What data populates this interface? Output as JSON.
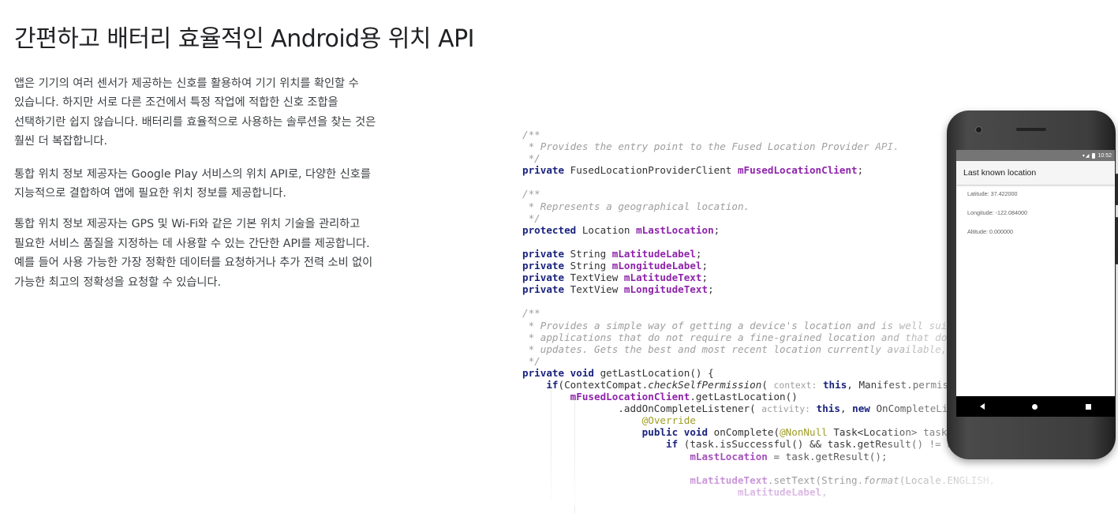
{
  "page": {
    "title": "간편하고 배터리 효율적인 Android용 위치 API",
    "paragraphs": [
      "앱은 기기의 여러 센서가 제공하는 신호를 활용하여 기기 위치를 확인할 수 있습니다. 하지만 서로 다른 조건에서 특정 작업에 적합한 신호 조합을 선택하기란 쉽지 않습니다. 배터리를 효율적으로 사용하는 솔루션을 찾는 것은 훨씬 더 복잡합니다.",
      "통합 위치 정보 제공자는 Google Play 서비스의 위치 API로, 다양한 신호를 지능적으로 결합하여 앱에 필요한 위치 정보를 제공합니다.",
      "통합 위치 정보 제공자는 GPS 및 Wi-Fi와 같은 기본 위치 기술을 관리하고 필요한 서비스 품질을 지정하는 데 사용할 수 있는 간단한 API를 제공합니다. 예를 들어 사용 가능한 가장 정확한 데이터를 요청하거나 추가 전력 소비 없이 가능한 최고의 정확성을 요청할 수 있습니다."
    ]
  },
  "code": {
    "lines": [
      [
        {
          "t": "/**",
          "c": "cm"
        }
      ],
      [
        {
          "t": " * Provides the entry point to the Fused Location Provider API.",
          "c": "cm"
        }
      ],
      [
        {
          "t": " */",
          "c": "cm"
        }
      ],
      [
        {
          "t": "private",
          "c": "kw"
        },
        {
          "t": " FusedLocationProviderClient "
        },
        {
          "t": "mFusedLocationClient",
          "c": "fd"
        },
        {
          "t": ";"
        }
      ],
      [],
      [
        {
          "t": "/**",
          "c": "cm"
        }
      ],
      [
        {
          "t": " * Represents a geographical location.",
          "c": "cm"
        }
      ],
      [
        {
          "t": " */",
          "c": "cm"
        }
      ],
      [
        {
          "t": "protected",
          "c": "kw"
        },
        {
          "t": " Location "
        },
        {
          "t": "mLastLocation",
          "c": "fd"
        },
        {
          "t": ";"
        }
      ],
      [],
      [
        {
          "t": "private",
          "c": "kw"
        },
        {
          "t": " String "
        },
        {
          "t": "mLatitudeLabel",
          "c": "fd"
        },
        {
          "t": ";"
        }
      ],
      [
        {
          "t": "private",
          "c": "kw"
        },
        {
          "t": " String "
        },
        {
          "t": "mLongitudeLabel",
          "c": "fd"
        },
        {
          "t": ";"
        }
      ],
      [
        {
          "t": "private",
          "c": "kw"
        },
        {
          "t": " TextView "
        },
        {
          "t": "mLatitudeText",
          "c": "fd"
        },
        {
          "t": ";"
        }
      ],
      [
        {
          "t": "private",
          "c": "kw"
        },
        {
          "t": " TextView "
        },
        {
          "t": "mLongitudeText",
          "c": "fd"
        },
        {
          "t": ";"
        }
      ],
      [],
      [
        {
          "t": "/**",
          "c": "cm"
        }
      ],
      [
        {
          "t": " * Provides a simple way of getting a device's location and is well suited for",
          "c": "cm"
        }
      ],
      [
        {
          "t": " * applications that do not require a fine-grained location and that do not need location",
          "c": "cm"
        }
      ],
      [
        {
          "t": " * updates. Gets the best and most recent location currently available, which may be null",
          "c": "cm"
        }
      ],
      [
        {
          "t": " */",
          "c": "cm"
        }
      ],
      [
        {
          "t": "private",
          "c": "kw"
        },
        {
          "t": " "
        },
        {
          "t": "void",
          "c": "kw"
        },
        {
          "t": " getLastLocation() {"
        }
      ],
      [
        {
          "t": "    "
        },
        {
          "t": "if",
          "c": "kw"
        },
        {
          "t": "(ContextCompat."
        },
        {
          "t": "checkSelfPermission",
          "c": "it"
        },
        {
          "t": "( "
        },
        {
          "t": "context:",
          "c": "hint"
        },
        {
          "t": " "
        },
        {
          "t": "this",
          "c": "kw"
        },
        {
          "t": ", Manifest.permission.ACCESS_FINE_LOCATION)"
        }
      ],
      [
        {
          "t": "        "
        },
        {
          "t": "mFusedLocationClient",
          "c": "fd"
        },
        {
          "t": ".getLastLocation()"
        }
      ],
      [
        {
          "t": "                .addOnCompleteListener( "
        },
        {
          "t": "activity:",
          "c": "hint"
        },
        {
          "t": " "
        },
        {
          "t": "this",
          "c": "kw"
        },
        {
          "t": ", "
        },
        {
          "t": "new",
          "c": "kw"
        },
        {
          "t": " OnCompleteListener<Location>() {"
        }
      ],
      [
        {
          "t": "                    "
        },
        {
          "t": "@Override",
          "c": "an"
        }
      ],
      [
        {
          "t": "                    "
        },
        {
          "t": "public",
          "c": "kw"
        },
        {
          "t": " "
        },
        {
          "t": "void",
          "c": "kw"
        },
        {
          "t": " onComplete("
        },
        {
          "t": "@NonNull",
          "c": "an"
        },
        {
          "t": " Task<Location> task) {"
        }
      ],
      [
        {
          "t": "                        "
        },
        {
          "t": "if",
          "c": "kw"
        },
        {
          "t": " (task.isSuccessful() && task.getResult() != null) {"
        }
      ],
      [
        {
          "t": "                            "
        },
        {
          "t": "mLastLocation",
          "c": "fd"
        },
        {
          "t": " = task.getResult();"
        }
      ],
      [],
      [
        {
          "t": "                            "
        },
        {
          "t": "mLatitudeText",
          "c": "fd"
        },
        {
          "t": ".setText(String."
        },
        {
          "t": "format",
          "c": "it"
        },
        {
          "t": "(Locale.ENGLISH, "
        }
      ],
      [
        {
          "t": "                                    "
        },
        {
          "t": "mLatitudeLabel",
          "c": "fd"
        },
        {
          "t": ","
        }
      ]
    ]
  },
  "phone": {
    "status_time": "10:52",
    "app_title": "Last known location",
    "fields": [
      "Latitude: 37.422000",
      "Longitude: -122.084000",
      "Altitude: 0.000000"
    ]
  },
  "colors": {
    "keyword": "#1a237e",
    "field": "#8e24aa",
    "comment": "#9e9e9e",
    "annotation": "#9e9d24"
  },
  "icons": [
    "back-icon",
    "home-icon",
    "recents-icon",
    "signal-icon",
    "battery-icon"
  ]
}
